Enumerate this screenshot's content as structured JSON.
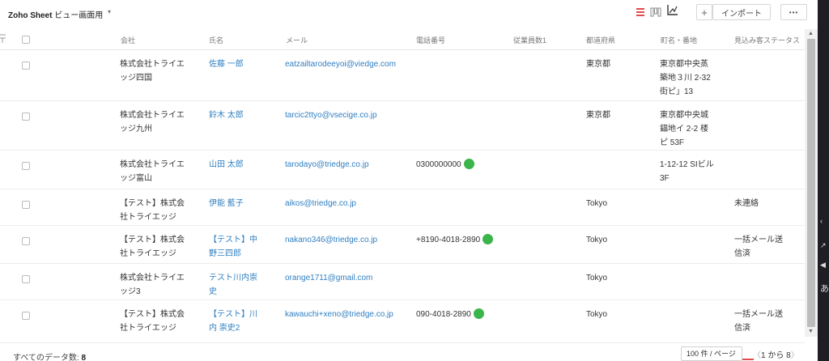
{
  "topbar": {
    "view_bold": "Zoho Sheet",
    "view_rest": " ビュー画面用",
    "import_label": "インポート",
    "plus_label": "+",
    "more_label": "•••"
  },
  "columns": [
    "会社",
    "氏名",
    "メール",
    "電話番号",
    "従業員数1",
    "都道府県",
    "町名・番地",
    "見込み客ステータス"
  ],
  "rows": [
    {
      "company": [
        "株式会社トライエ",
        "ッジ四国"
      ],
      "name": [
        "佐藤 一郎"
      ],
      "email": "eatzailtarodeeyoi@viedge.com",
      "phone": "",
      "employees": "",
      "pref": "東京都",
      "address": [
        "東京都中央蒸",
        "築地３川 2-32",
        "街ピ」13"
      ],
      "status": []
    },
    {
      "company": [
        "株式会社トライエ",
        "ッジ九州"
      ],
      "name": [
        "鈴木 太郎"
      ],
      "email": "tarcic2ttyo@vsecige.co.jp",
      "phone": "",
      "employees": "",
      "pref": "東京都",
      "address": [
        "東京都中央城",
        "錨地イ 2-2 楼",
        "ピ 53F"
      ],
      "status": []
    },
    {
      "company": [
        "株式会社トライエ",
        "ッジ富山"
      ],
      "name": [
        "山田 太郎"
      ],
      "email": "tarodayo@triedge.co.jp",
      "phone": "0300000000",
      "employees": "",
      "pref": "",
      "address": [
        "1-12-12 SIビル",
        "3F"
      ],
      "status": []
    },
    {
      "company": [
        "【テスト】株式会",
        "社トライエッジ"
      ],
      "name": [
        "伊能 藍子"
      ],
      "email": "aikos@triedge.co.jp",
      "phone": "",
      "employees": "",
      "pref": "Tokyo",
      "address": [],
      "status": [
        "未連絡"
      ]
    },
    {
      "company": [
        "【テスト】株式会",
        "社トライエッジ"
      ],
      "name": [
        "【テスト】中",
        "野三四郎"
      ],
      "email": "nakano346@triedge.co.jp",
      "phone": "+8190-4018-2890",
      "employees": "",
      "pref": "Tokyo",
      "address": [],
      "status": [
        "一括メール送",
        "信済"
      ]
    },
    {
      "company": [
        "株式会社トライエ",
        "ッジ3"
      ],
      "name": [
        "テスト川内崇",
        "史"
      ],
      "email": "orange1711@gmail.com",
      "phone": "",
      "employees": "",
      "pref": "Tokyo",
      "address": [],
      "status": []
    },
    {
      "company": [
        "【テスト】株式会",
        "社トライエッジ"
      ],
      "name": [
        "【テスト】川",
        "内 崇史2"
      ],
      "email": "kawauchi+xeno@triedge.co.jp",
      "phone": "090-4018-2890",
      "employees": "",
      "pref": "Tokyo",
      "address": [],
      "status": [
        "一括メール送",
        "信済"
      ]
    }
  ],
  "footer": {
    "count_label": "すべてのデータ数: ",
    "count_value": "8",
    "per_page": "100 件 / ページ",
    "pager": "1 から 8"
  },
  "colors": {
    "link": "#2f7fc1",
    "phone": "#3bb54a",
    "accent": "#e24b4b"
  },
  "edge_text": [
    "あ"
  ]
}
